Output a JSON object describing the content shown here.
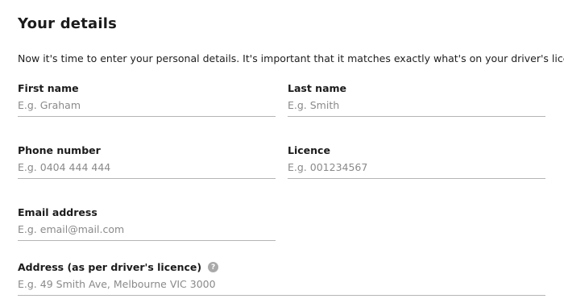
{
  "header": {
    "title": "Your details",
    "intro": "Now it's time to enter your personal details. It's important that it matches exactly what's on your driver's licence."
  },
  "form": {
    "first_name": {
      "label": "First name",
      "placeholder": "E.g. Graham",
      "value": ""
    },
    "last_name": {
      "label": "Last name",
      "placeholder": "E.g. Smith",
      "value": ""
    },
    "phone": {
      "label": "Phone number",
      "placeholder": "E.g. 0404 444 444",
      "value": ""
    },
    "licence": {
      "label": "Licence",
      "placeholder": "E.g. 001234567",
      "value": ""
    },
    "email": {
      "label": "Email address",
      "placeholder": "E.g. email@mail.com",
      "value": ""
    },
    "address": {
      "label": "Address (as per driver's licence)",
      "placeholder": "E.g. 49 Smith Ave, Melbourne VIC 3000",
      "value": "",
      "help_icon": "help-icon"
    }
  },
  "colors": {
    "text": "#1e1e1e",
    "placeholder": "#8a8a8a",
    "underline": "#b5b5b5",
    "help_icon": "#a9a9a9"
  }
}
